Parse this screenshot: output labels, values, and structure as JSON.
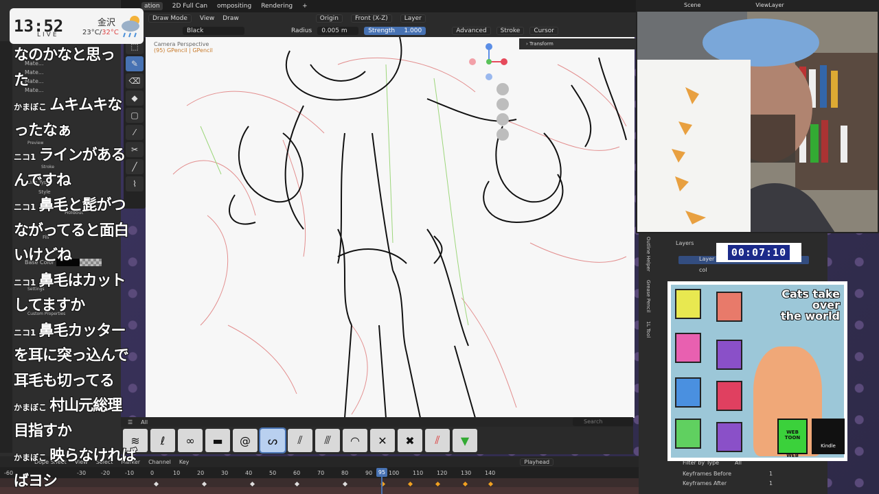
{
  "clock": {
    "time": "13:52",
    "live": "LIVE",
    "city": "金沢",
    "temp_low": "23°C",
    "temp_sep": "/",
    "temp_high": "32°C"
  },
  "top_menu": {
    "tabs": [
      "ation",
      "2D Full Can",
      "ompositing",
      "Rendering",
      "+"
    ]
  },
  "header": {
    "mode": "Draw Mode",
    "view": "View",
    "draw": "Draw",
    "origin": "Origin",
    "projection": "Front (X-Z)",
    "layer": "Layer"
  },
  "tool_settings": {
    "color_name": "Black",
    "radius_label": "Radius",
    "radius_value": "0.005 m",
    "strength_label": "Strength",
    "strength_value": "1.000",
    "advanced": "Advanced",
    "stroke": "Stroke",
    "cursor": "Cursor"
  },
  "viewport": {
    "camera_label": "Camera Perspective",
    "camera_sub": "(95) GPencil | GPencil",
    "transform_tab": "Transform"
  },
  "left_panel": {
    "materials": [
      "Mate...",
      "Mate...",
      "Mate...",
      "Mate..."
    ],
    "preview": "Preview",
    "stroke": "Stroke",
    "line_type": "Line Type",
    "line_value": "Line",
    "style": "Style",
    "holdout": "Holdout",
    "fill": "Fill",
    "base_color": "Base Color",
    "settings": "Settings",
    "custom_props": "Custom Properties"
  },
  "comments": [
    {
      "tag": "",
      "text": "なのかなと思っ"
    },
    {
      "tag": "",
      "text": "た"
    },
    {
      "tag": "かまぼこ",
      "text": "ムキムキな"
    },
    {
      "tag": "",
      "text": "ったなぁ"
    },
    {
      "tag": "ニコ1",
      "text": "ラインがある"
    },
    {
      "tag": "",
      "text": "んですね"
    },
    {
      "tag": "ニコ1",
      "text": "鼻毛と髭がつ"
    },
    {
      "tag": "",
      "text": "ながってると面白"
    },
    {
      "tag": "",
      "text": "いけどね"
    },
    {
      "tag": "ニコ1",
      "text": "鼻毛はカット"
    },
    {
      "tag": "",
      "text": "してますか"
    },
    {
      "tag": "ニコ1",
      "text": "鼻毛カッター"
    },
    {
      "tag": "",
      "text": "を耳に突っ込んで"
    },
    {
      "tag": "",
      "text": "耳毛も切ってる"
    },
    {
      "tag": "かまぼこ",
      "text": "村山元総理"
    },
    {
      "tag": "",
      "text": "目指すか"
    },
    {
      "tag": "かまぼこ",
      "text": "映らなければ"
    },
    {
      "tag": "",
      "text": "ばヨシ"
    }
  ],
  "brush_bar": {
    "all": "All",
    "search_placeholder": "Search"
  },
  "timeline": {
    "editor": "Dope Sheet",
    "menus": [
      "View",
      "Select",
      "Marker",
      "Channel",
      "Key"
    ],
    "playhead_label": "Playhead",
    "ticks": [
      "-60",
      "-30",
      "-20",
      "-10",
      "0",
      "10",
      "20",
      "30",
      "40",
      "50",
      "60",
      "70",
      "80",
      "90",
      "100",
      "110",
      "120",
      "130",
      "140"
    ],
    "current_frame": "95"
  },
  "scene_bar": {
    "scene": "Scene",
    "view_layer": "ViewLayer"
  },
  "right_panel": {
    "tabs": [
      "Outline Helper",
      "Grease Pencil",
      "1L Tool"
    ],
    "layers_header": "Layers",
    "layers": [
      "Layer",
      "col"
    ],
    "timer": "00:07:10",
    "filter": "Filter by Type",
    "filter_value": "All",
    "kf_before_label": "Keyframes Before",
    "kf_before_value": "1",
    "kf_after_label": "Keyframes After",
    "kf_after_value": "1"
  },
  "book_ad": {
    "title_lines": [
      "Cats take",
      "over",
      "the world"
    ],
    "webtoon": "WEB TOON",
    "webtoon_sub": "WEB TOON",
    "kindle": "Kindle"
  }
}
